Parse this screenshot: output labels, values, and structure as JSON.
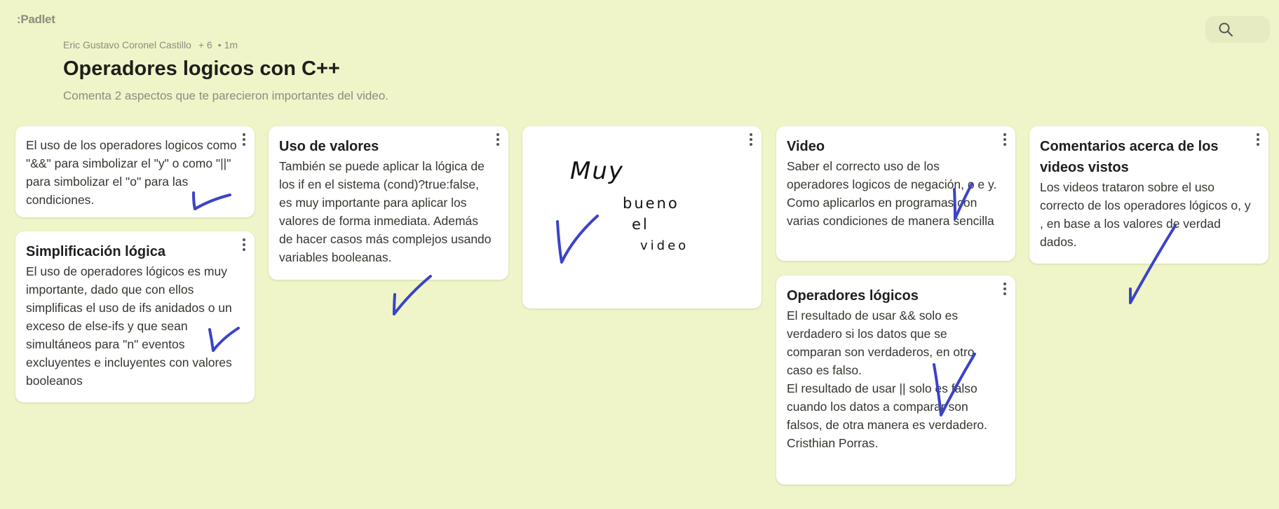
{
  "app": {
    "logo_text": ":Padlet"
  },
  "search": {
    "icon": "search-icon"
  },
  "header": {
    "author": "Eric Gustavo Coronel Castillo",
    "contributors": "+ 6",
    "separator": "•",
    "time": "1m",
    "title": "Operadores logicos con C++",
    "subtitle": "Comenta 2 aspectos que te parecieron importantes del video."
  },
  "posts": [
    {
      "title": "",
      "body": "El uso de los operadores logicos como \"&&\" para simbolizar el \"y\" o como \"||\" para simbolizar el \"o\" para las condiciones."
    },
    {
      "title": "Simplificación lógica",
      "body": "El uso de operadores lógicos es muy importante, dado que con ellos simplificas el uso de ifs anidados o un exceso de else-ifs y que sean simultáneos para \"n\" eventos excluyentes e incluyentes con valores booleanos"
    },
    {
      "title": "Uso de valores",
      "body": "También se puede aplicar la lógica de los if en el sistema (cond)?true:false, es muy importante para aplicar los valores de forma inmediata. Además de hacer casos más complejos usando variables booleanas."
    },
    {
      "title": "",
      "body": "",
      "drawing": "handwritten-note"
    },
    {
      "title": "Video",
      "body": "Saber el correcto uso de los operadores logicos de negación, o e y.\nComo aplicarlos en programas con varias condiciones de manera sencilla"
    },
    {
      "title": "Operadores lógicos",
      "body": "El resultado de usar && solo es verdadero si los datos que se comparan son verdaderos, en otro caso es falso.\nEl resultado de usar || solo es falso cuando los datos a comparar son falsos, de otra manera es verdadero.\nCristhian Porras."
    },
    {
      "title": "Comentarios acerca de los videos vistos",
      "body": "Los videos trataron sobre el uso correcto de los operadores lógicos o, y , en base a los valores de verdad dados."
    }
  ],
  "handwriting": {
    "line1": "Muy",
    "line2": "bueno",
    "line3": "el",
    "line4": "video"
  },
  "colors": {
    "background": "#eff5c8",
    "card": "#ffffff",
    "checkmark_ink": "#3a43c8"
  }
}
